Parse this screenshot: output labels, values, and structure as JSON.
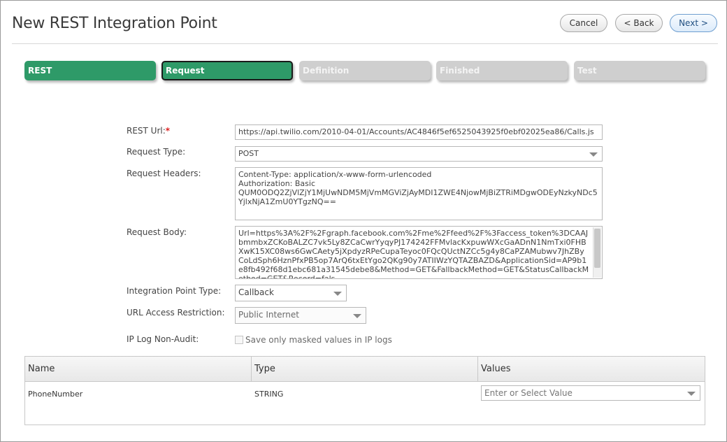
{
  "header": {
    "title": "New REST Integration Point",
    "cancel_label": "Cancel",
    "back_label": "< Back",
    "next_label": "Next >"
  },
  "steps": [
    {
      "label": "REST",
      "state": "done"
    },
    {
      "label": "Request",
      "state": "active"
    },
    {
      "label": "Definition",
      "state": "todo"
    },
    {
      "label": "Finished",
      "state": "todo"
    },
    {
      "label": "Test",
      "state": "todo"
    }
  ],
  "form": {
    "rest_url_label": "REST Url:",
    "required_marker": "*",
    "rest_url_value": "https://api.twilio.com/2010-04-01/Accounts/AC4846f5ef6525043925f0ebf02025ea86/Calls.js",
    "request_type_label": "Request Type:",
    "request_type_value": "POST",
    "request_headers_label": "Request Headers:",
    "request_headers_value": "Content-Type: application/x-www-form-urlencoded\nAuthorization: Basic\nQUM0ODQ2ZjVlZjY1MjUwNDM5MjVmMGViZjAyMDI1ZWE4NjowMjBiZTRiMDgwODEyNzkyNDc5YjlxNjA1ZmU0YTgzNQ==",
    "request_body_label": "Request Body:",
    "request_body_value": "Url=https%3A%2F%2Fgraph.facebook.com%2Fme%2Ffeed%2F%3Faccess_token%3DCAAJbmmbxZCKoBALZC7vk5Ly8ZCaCwrYyqyPJ174242FFMvlacKxpuwWXcGaADnN1NmTxi0FHBXwK15XC08ws6GwCAety5jXpdyzRPeCupaTeyoc0FQcQUctNZCc5g4y8CaPZAMubwv7JhZByCoLdSph6HznPfxPB5op7ArQ6txEtYgo2QKg90y7ATIIWzYQTAZBAZD&ApplicationSid=AP9b1e8fb492f68d1ebc681a31545debe8&Method=GET&FallbackMethod=GET&StatusCallbackMethod=GET&Record=fals",
    "integration_point_type_label": "Integration Point Type:",
    "integration_point_type_value": "Callback",
    "url_access_restriction_label": "URL Access Restriction:",
    "url_access_restriction_value": "Public Internet",
    "ip_log_label": "IP Log Non-Audit:",
    "ip_log_checkbox_label": "Save only masked values in IP logs",
    "ip_log_checked": false
  },
  "grid": {
    "columns": [
      "Name",
      "Type",
      "Values"
    ],
    "rows": [
      {
        "name": "PhoneNumber",
        "type": "STRING",
        "value_placeholder": "Enter or Select Value"
      }
    ]
  },
  "icons": {
    "dropdown": "chevron-down-icon",
    "checkbox": "checkbox-icon"
  },
  "colors": {
    "step_done": "#2e9a68",
    "step_todo": "#cfcfcf",
    "required": "#dd2222"
  }
}
